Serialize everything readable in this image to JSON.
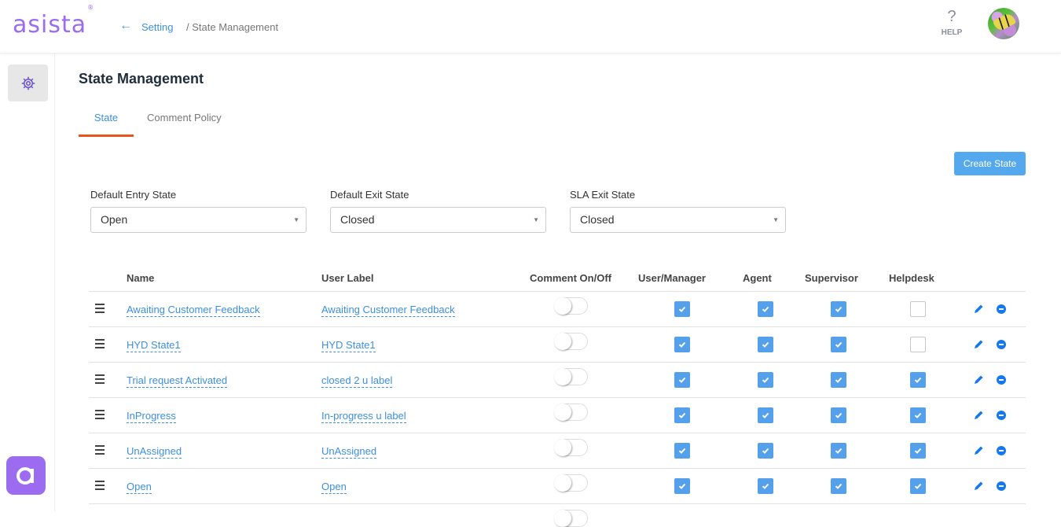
{
  "header": {
    "logo": "asista",
    "logo_mark": "®",
    "breadcrumb": {
      "back_icon": "arrow-left-icon",
      "parent": "Setting",
      "current": "/ State Management"
    },
    "help": {
      "icon": "?",
      "label": "HELP"
    },
    "avatar": "butterfly-avatar"
  },
  "sidebar": {
    "items": [
      {
        "icon": "gear-icon",
        "active": true
      }
    ],
    "app_button": {
      "icon": "asista-a-icon",
      "glyph": "a"
    }
  },
  "main": {
    "title": "State Management",
    "tabs": [
      {
        "label": "State",
        "active": true
      },
      {
        "label": "Comment Policy",
        "active": false
      }
    ],
    "create_button": "Create State",
    "fields": [
      {
        "label": "Default Entry State",
        "value": "Open"
      },
      {
        "label": "Default Exit State",
        "value": "Closed"
      },
      {
        "label": "SLA Exit State",
        "value": "Closed"
      }
    ],
    "table": {
      "columns": [
        "Name",
        "User Label",
        "Comment On/Off",
        "User/Manager",
        "Agent",
        "Supervisor",
        "Helpdesk"
      ],
      "rows": [
        {
          "name": "Awaiting Customer Feedback",
          "user_label": "Awaiting Customer Feedback",
          "comment": false,
          "user_manager": true,
          "agent": true,
          "supervisor": true,
          "helpdesk": false
        },
        {
          "name": "HYD State1",
          "user_label": "HYD State1",
          "comment": false,
          "user_manager": true,
          "agent": true,
          "supervisor": true,
          "helpdesk": false
        },
        {
          "name": "Trial request Activated",
          "user_label": "closed 2 u label",
          "comment": false,
          "user_manager": true,
          "agent": true,
          "supervisor": true,
          "helpdesk": true
        },
        {
          "name": "InProgress",
          "user_label": "In-progress u label",
          "comment": false,
          "user_manager": true,
          "agent": true,
          "supervisor": true,
          "helpdesk": true
        },
        {
          "name": "UnAssigned",
          "user_label": "UnAssigned",
          "comment": false,
          "user_manager": true,
          "agent": true,
          "supervisor": true,
          "helpdesk": true
        },
        {
          "name": "Open",
          "user_label": "Open",
          "comment": false,
          "user_manager": true,
          "agent": true,
          "supervisor": true,
          "helpdesk": true
        }
      ]
    }
  },
  "colors": {
    "brand": "#9b6cf0",
    "link": "#3d8fe0",
    "tab_indicator": "#e8541e",
    "button": "#54a8ee",
    "checkbox_on": "#54a0ea",
    "remove_icon": "#1478f0"
  }
}
